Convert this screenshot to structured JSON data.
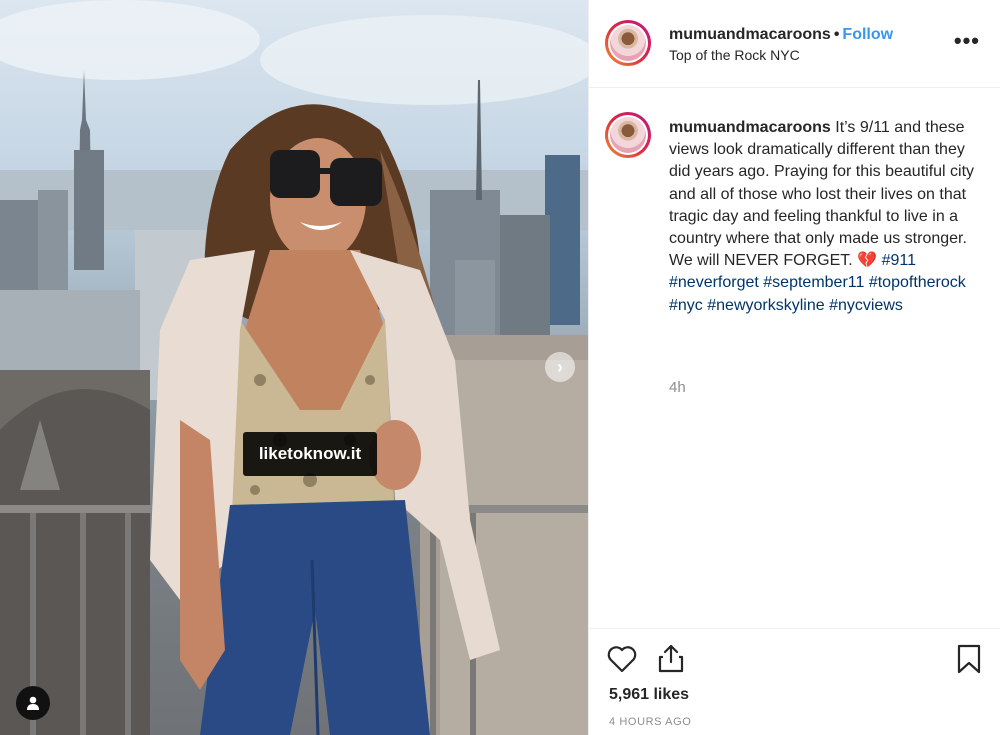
{
  "header": {
    "username": "mumuandmacaroons",
    "separator": "•",
    "follow_label": "Follow",
    "location": "Top of the Rock NYC",
    "more_label": "•••"
  },
  "photo": {
    "overlay_tag": "liketoknow.it",
    "next_icon": "chevron-right-icon",
    "user_tag_icon": "user-icon"
  },
  "caption": {
    "username": "mumuandmacaroons",
    "text": "It’s 9/11 and these views look dramatically different than they did years ago. Praying for this beautiful city and all of those who lost their lives on that tragic day and feeling thankful to live in a country where that only made us stronger. We will NEVER FORGET.",
    "emoji": "💔",
    "hashtags": "#911 #neverforget #september11 #topoftherock #nyc #newyorkskyline #nycviews",
    "time": "4h"
  },
  "actions": {
    "like_icon": "heart-icon",
    "share_icon": "share-icon",
    "save_icon": "bookmark-icon",
    "likes": "5,961 likes",
    "posted": "4 HOURS AGO"
  },
  "colors": {
    "link_blue": "#3897f0",
    "hashtag_blue": "#003569",
    "muted": "#8e8e8e"
  }
}
